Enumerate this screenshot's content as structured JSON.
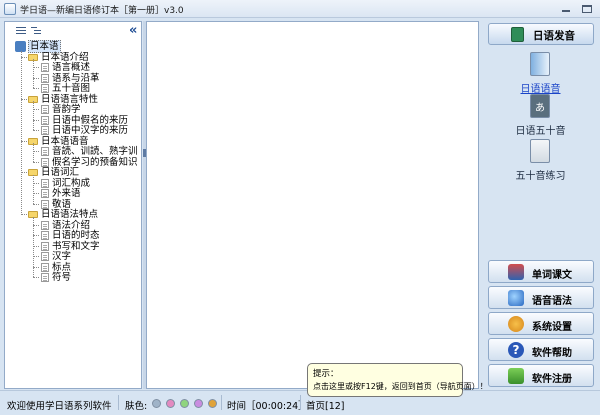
{
  "window": {
    "title": "学日语—新编日语修订本［第一册］v3.0"
  },
  "tree": {
    "root": "日本语",
    "groups": [
      {
        "label": "日本语介绍",
        "items": [
          "语言概述",
          "语系与沿革",
          "五十音图"
        ]
      },
      {
        "label": "日语语言特性",
        "items": [
          "音韵学",
          "日语中假名的来历",
          "日语中汉字的来历"
        ]
      },
      {
        "label": "日本语语音",
        "items": [
          "音読、训読、熟字训",
          "假名学习的预备知识"
        ]
      },
      {
        "label": "日语词汇",
        "items": [
          "词汇构成",
          "外来语",
          "敬语"
        ]
      },
      {
        "label": "日语语法特点",
        "items": [
          "语法介绍",
          "日语的时态",
          "书写和文字",
          "汉字",
          "标点",
          "符号"
        ]
      }
    ]
  },
  "right_panel": {
    "section": "日语发音",
    "lessons": [
      "日语语音",
      "日语五十音",
      "五十音练习"
    ],
    "buttons": [
      "单词课文",
      "语音语法",
      "系统设置",
      "软件帮助",
      "软件注册"
    ]
  },
  "hint": {
    "title": "提示：",
    "body": "点击这里或按F12键，返回到首页（导航页面）！"
  },
  "status": {
    "welcome": "欢迎使用学日语系列软件",
    "skin_label": "肤色:",
    "skin_colors": [
      "#9fb3c8",
      "#e38ac0",
      "#8fd47f",
      "#c98de0",
      "#e0a33a"
    ],
    "time": "时间［00:00:24］",
    "page": "首页[12]"
  },
  "colors": {
    "accent": "#1a44c8",
    "frame": "#d7e4f2",
    "hint_bg": "#ffffe1"
  }
}
